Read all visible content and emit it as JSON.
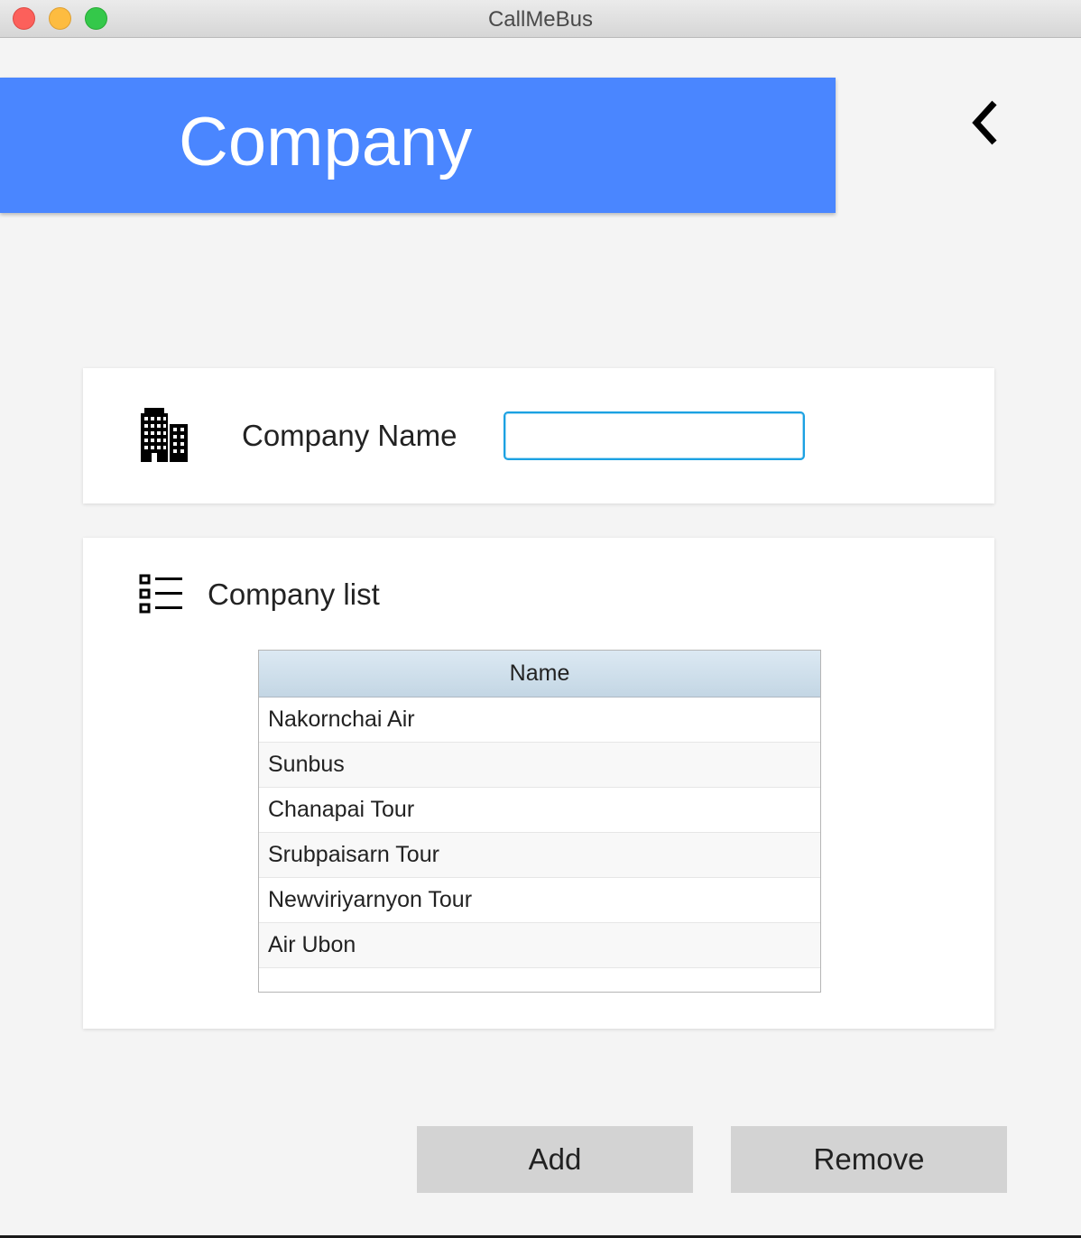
{
  "window": {
    "title": "CallMeBus"
  },
  "header": {
    "title": "Company",
    "accent_color": "#4a86ff",
    "back_icon": "chevron-left-icon"
  },
  "company_form": {
    "icon": "building-icon",
    "label": "Company Name",
    "input_value": ""
  },
  "company_list": {
    "icon": "list-icon",
    "label": "Company list",
    "columns": [
      "Name"
    ],
    "rows": [
      "Nakornchai Air",
      "Sunbus",
      "Chanapai Tour",
      "Srubpaisarn Tour",
      "Newviriyarnyon Tour",
      "Air Ubon"
    ]
  },
  "actions": {
    "add_label": "Add",
    "remove_label": "Remove"
  }
}
